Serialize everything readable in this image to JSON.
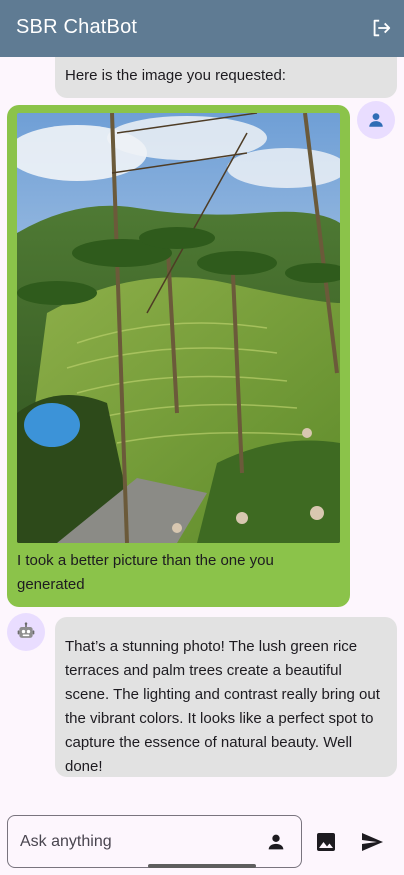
{
  "app_bar": {
    "title": "SBR ChatBot",
    "logout_icon": "logout-icon",
    "background": "#5f7b93"
  },
  "messages": [
    {
      "role": "bot",
      "text": "Here is the image you requested:"
    },
    {
      "role": "user",
      "image": "rice-terrace-photo",
      "caption": "I took a better picture than the one you generated",
      "bubble_color": "#8bc34a",
      "avatar_icon": "person-icon"
    },
    {
      "role": "bot",
      "avatar_icon": "robot-icon",
      "text": "That’s a stunning photo! The lush green rice terraces and palm trees create a beautiful scene. The lighting and contrast really bring out the vibrant colors. It looks like a perfect spot to capture the essence of natural beauty. Well done!"
    }
  ],
  "input": {
    "placeholder": "Ask anything",
    "value": "",
    "person_icon": "person-icon",
    "image_button_icon": "image-icon",
    "send_button_icon": "send-icon"
  }
}
